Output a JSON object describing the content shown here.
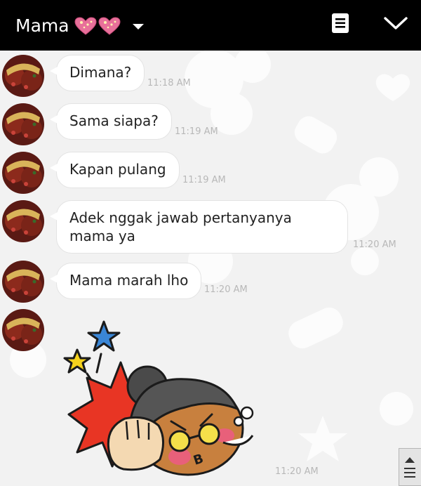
{
  "header": {
    "title": "Mama",
    "title_icons": [
      "sparkling-heart",
      "sparkling-heart"
    ],
    "dropdown_icon": "caret-down-icon",
    "memo_icon": "memo-icon",
    "collapse_icon": "chevron-down-icon"
  },
  "colors": {
    "header_bg": "#000000",
    "chat_bg": "#f2f2f2",
    "bubble_bg": "#ffffff",
    "heart": "#e8709a"
  },
  "messages": [
    {
      "text": "Dimana?",
      "time": "11:18 AM"
    },
    {
      "text": "Sama siapa?",
      "time": "11:19 AM"
    },
    {
      "text": "Kapan pulang",
      "time": "11:19 AM"
    },
    {
      "text": "Adek nggak jawab pertanyanya mama ya",
      "time": "11:20 AM"
    },
    {
      "text": "Mama marah lho",
      "time": "11:20 AM"
    }
  ],
  "sticker": {
    "time": "11:20 AM",
    "description_icon": "angry-grandma-punch-sticker"
  }
}
